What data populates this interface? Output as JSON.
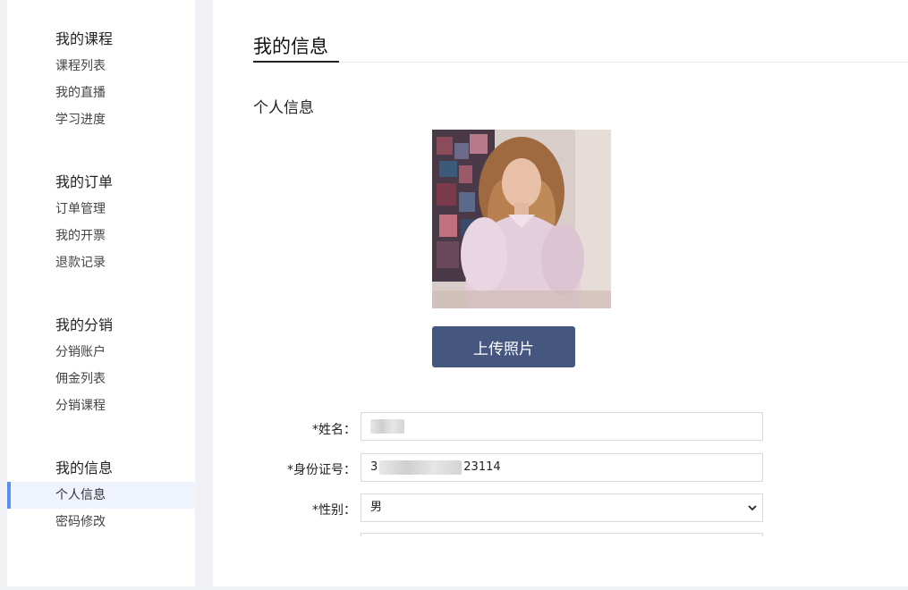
{
  "sidebar": {
    "groups": [
      {
        "title": "我的课程",
        "items": [
          "课程列表",
          "我的直播",
          "学习进度"
        ]
      },
      {
        "title": "我的订单",
        "items": [
          "订单管理",
          "我的开票",
          "退款记录"
        ]
      },
      {
        "title": "我的分销",
        "items": [
          "分销账户",
          "佣金列表",
          "分销课程"
        ]
      },
      {
        "title": "我的信息",
        "items": [
          "个人信息",
          "密码修改"
        ]
      }
    ],
    "active_item": "个人信息",
    "active_color": "#5b8ef0"
  },
  "main": {
    "page_title": "我的信息",
    "section_title": "个人信息",
    "upload_button": "上传照片",
    "button_color": "#46577f"
  },
  "form": {
    "name_label": "*姓名：",
    "id_label": "*身份证号：",
    "id_value_start": "3",
    "id_value_end": "23114",
    "gender_label": "*性别：",
    "gender_value": "男"
  }
}
